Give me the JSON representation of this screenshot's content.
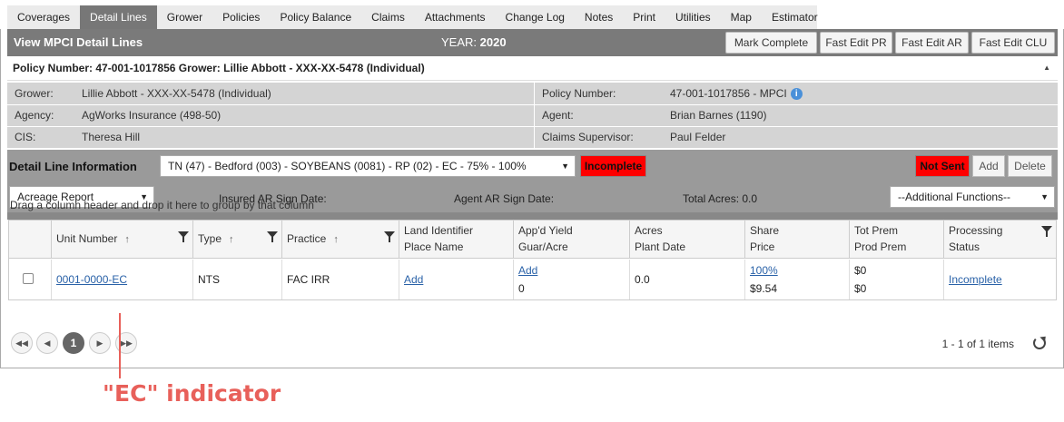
{
  "tabs": [
    "Coverages",
    "Detail Lines",
    "Grower",
    "Policies",
    "Policy Balance",
    "Claims",
    "Attachments",
    "Change Log",
    "Notes",
    "Print",
    "Utilities",
    "Map",
    "Estimator"
  ],
  "active_tab": "Detail Lines",
  "header": {
    "title": "View MPCI Detail Lines",
    "year_label": "YEAR:",
    "year_value": "2020",
    "buttons": [
      "Mark Complete",
      "Fast Edit PR",
      "Fast Edit AR",
      "Fast Edit CLU"
    ]
  },
  "policy_header": "Policy Number: 47-001-1017856 Grower: Lillie Abbott - XXX-XX-5478 (Individual)",
  "info": {
    "grower_label": "Grower:",
    "grower_value": "Lillie Abbott - XXX-XX-5478 (Individual)",
    "agency_label": "Agency:",
    "agency_value": "AgWorks Insurance (498-50)",
    "cis_label": "CIS:",
    "cis_value": "Theresa Hill",
    "policy_label": "Policy Number:",
    "policy_value": "47-001-1017856 - MPCI",
    "agent_label": "Agent:",
    "agent_value": "Brian Barnes (1190)",
    "claims_label": "Claims Supervisor:",
    "claims_value": "Paul Felder"
  },
  "detail": {
    "label": "Detail Line Information",
    "selected_line": "TN (47) - Bedford (003) - SOYBEANS (0081) - RP (02) - EC - 75% - 100%",
    "status_badge": "Incomplete",
    "sent_badge": "Not Sent",
    "add_label": "Add",
    "delete_label": "Delete",
    "report_select": "Acreage Report",
    "insured_ar": "Insured AR Sign Date:",
    "agent_ar": "Agent AR Sign Date:",
    "total_acres": "Total Acres: 0.0",
    "additional": "--Additional Functions--"
  },
  "grid": {
    "group_hint": "Drag a column header and drop it here to group by that column",
    "headers": {
      "unit": "Unit Number",
      "type": "Type",
      "practice": "Practice",
      "land1": "Land Identifier",
      "land2": "Place Name",
      "yield1": "App'd Yield",
      "yield2": "Guar/Acre",
      "acres1": "Acres",
      "acres2": "Plant Date",
      "share1": "Share",
      "share2": "Price",
      "prem1": "Tot Prem",
      "prem2": "Prod Prem",
      "proc1": "Processing",
      "proc2": "Status"
    },
    "row": {
      "unit": "0001-0000-EC",
      "type": "NTS",
      "practice": "FAC IRR",
      "land": "Add",
      "yield_a": "Add",
      "yield_b": "0",
      "acres": "0.0",
      "share": "100%",
      "price": "$9.54",
      "tot_prem": "$0",
      "prod_prem": "$0",
      "status": "Incomplete"
    }
  },
  "pager": {
    "current": "1",
    "items": "1 - 1 of 1 items"
  },
  "annotation": "\"EC\" indicator"
}
